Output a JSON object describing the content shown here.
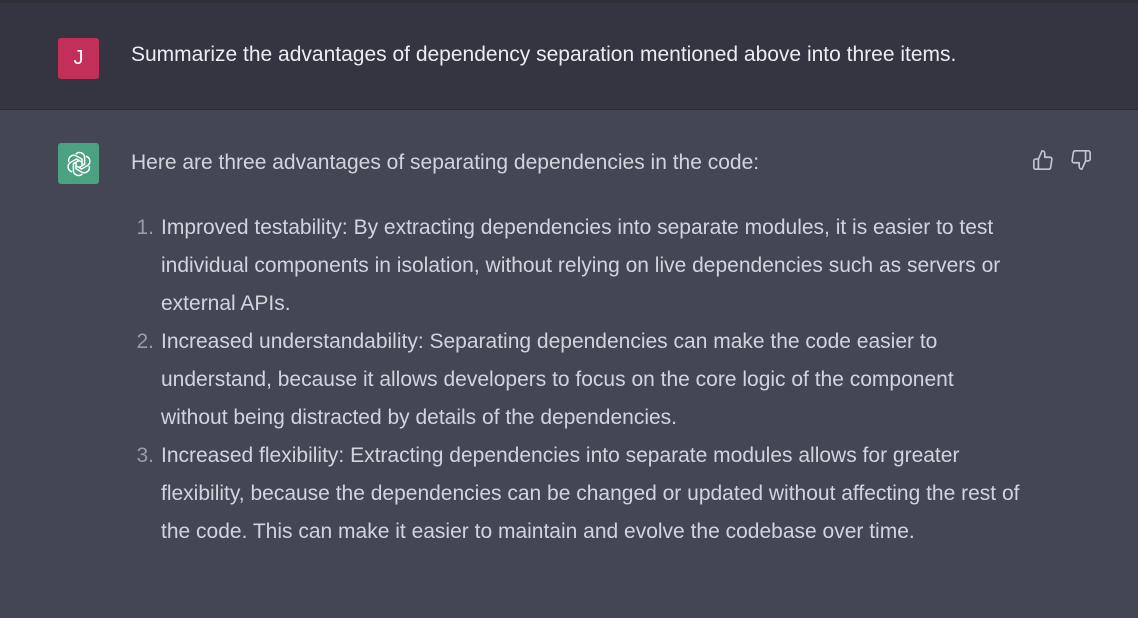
{
  "user_message": {
    "avatar_initial": "J",
    "text": "Summarize the advantages of dependency separation mentioned above into three items."
  },
  "assistant_message": {
    "intro": "Here are three advantages of separating dependencies in the code:",
    "items": [
      {
        "number": "1.",
        "text": "Improved testability: By extracting dependencies into separate modules, it is easier to test individual components in isolation, without relying on live dependencies such as servers or external APIs."
      },
      {
        "number": "2.",
        "text": "Increased understandability: Separating dependencies can make the code easier to understand, because it allows developers to focus on the core logic of the component without being distracted by details of the dependencies."
      },
      {
        "number": "3.",
        "text": "Increased flexibility: Extracting dependencies into separate modules allows for greater flexibility, because the dependencies can be changed or updated without affecting the rest of the code. This can make it easier to maintain and evolve the codebase over time."
      }
    ]
  },
  "icons": {
    "user_avatar": "user-avatar-icon",
    "assistant_avatar": "openai-logo-icon",
    "thumbs_up": "thumbs-up-icon",
    "thumbs_down": "thumbs-down-icon"
  },
  "colors": {
    "user_row_bg": "#343541",
    "assistant_row_bg": "#444654",
    "user_avatar_bg": "#c2305a",
    "assistant_avatar_bg": "#4aa281"
  }
}
